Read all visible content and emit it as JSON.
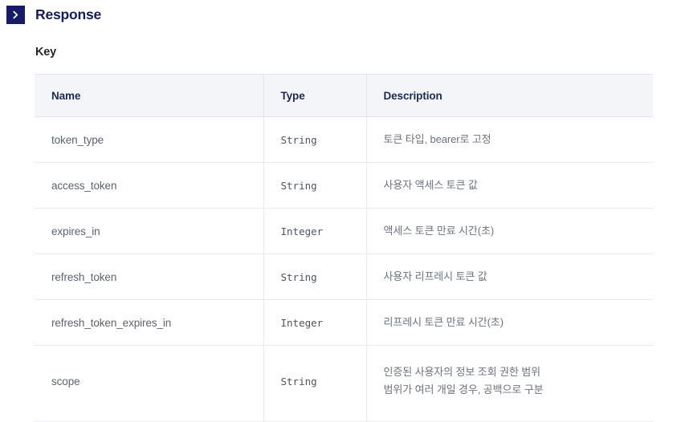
{
  "section": {
    "toggle_icon": "chevron-right-icon",
    "title": "Response",
    "accent_color": "#151b68",
    "title_color": "#141e55"
  },
  "sub_section": {
    "label": "Key"
  },
  "table": {
    "columns": [
      "Name",
      "Type",
      "Description"
    ],
    "header_background": "#f4f5f9",
    "border_color": "#e9eaef",
    "rows": [
      {
        "name": "token_type",
        "type": "String",
        "description_lines": [
          "토큰 타입, bearer로 고정"
        ]
      },
      {
        "name": "access_token",
        "type": "String",
        "description_lines": [
          "사용자 액세스 토큰 값"
        ]
      },
      {
        "name": "expires_in",
        "type": "Integer",
        "description_lines": [
          "액세스 토큰 만료 시간(초)"
        ]
      },
      {
        "name": "refresh_token",
        "type": "String",
        "description_lines": [
          "사용자 리프레시 토큰 값"
        ]
      },
      {
        "name": "refresh_token_expires_in",
        "type": "Integer",
        "description_lines": [
          "리프레시 토큰 만료 시간(초)"
        ]
      },
      {
        "name": "scope",
        "type": "String",
        "description_lines": [
          "인증된 사용자의 정보 조회 권한 범위",
          "범위가 여러 개일 경우, 공백으로 구분"
        ]
      }
    ]
  }
}
